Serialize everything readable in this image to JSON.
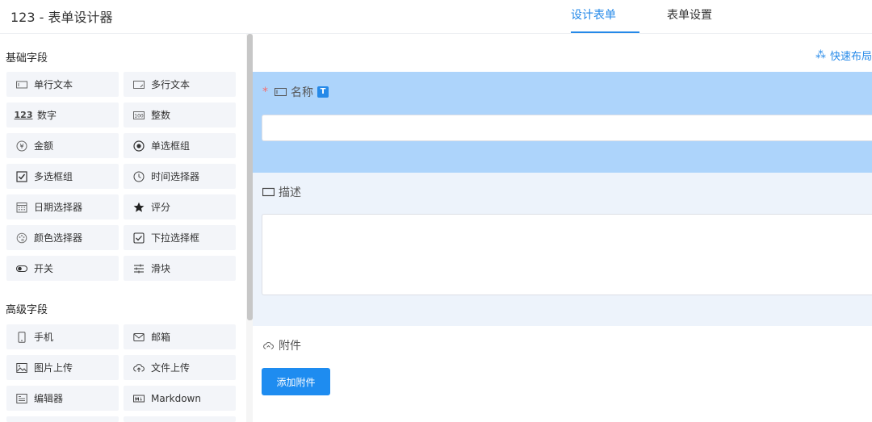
{
  "header": {
    "app_title": "123 - 表单设计器",
    "tabs": [
      {
        "label": "设计表单",
        "active": true
      },
      {
        "label": "表单设置",
        "active": false
      }
    ]
  },
  "sidebar": {
    "basic_title": "基础字段",
    "basic_fields": [
      {
        "label": "单行文本",
        "icon": "input-icon"
      },
      {
        "label": "多行文本",
        "icon": "textarea-icon"
      },
      {
        "label": "数字",
        "icon": "number-123-icon"
      },
      {
        "label": "整数",
        "icon": "integer-icon"
      },
      {
        "label": "金额",
        "icon": "yuan-icon"
      },
      {
        "label": "单选框组",
        "icon": "radio-icon"
      },
      {
        "label": "多选框组",
        "icon": "checkbox-icon"
      },
      {
        "label": "时间选择器",
        "icon": "clock-icon"
      },
      {
        "label": "日期选择器",
        "icon": "calendar-icon"
      },
      {
        "label": "评分",
        "icon": "star-icon"
      },
      {
        "label": "颜色选择器",
        "icon": "palette-icon"
      },
      {
        "label": "下拉选择框",
        "icon": "select-icon"
      },
      {
        "label": "开关",
        "icon": "switch-icon"
      },
      {
        "label": "滑块",
        "icon": "slider-icon"
      }
    ],
    "advanced_title": "高级字段",
    "advanced_fields": [
      {
        "label": "手机",
        "icon": "phone-icon"
      },
      {
        "label": "邮箱",
        "icon": "mail-icon"
      },
      {
        "label": "图片上传",
        "icon": "image-icon"
      },
      {
        "label": "文件上传",
        "icon": "cloud-upload-icon"
      },
      {
        "label": "编辑器",
        "icon": "editor-icon"
      },
      {
        "label": "Markdown",
        "icon": "markdown-icon"
      }
    ]
  },
  "canvas": {
    "quick_layout_label": "快速布局",
    "fields": {
      "name_label": "名称",
      "name_tag": "T",
      "desc_label": "描述",
      "attach_label": "附件",
      "upload_button": "添加附件"
    }
  },
  "colors": {
    "accent": "#2589e8",
    "selected_block": "#add4fb",
    "block_bg": "#edf3fb",
    "required": "#f56c6c",
    "button": "#1e8cf0"
  }
}
